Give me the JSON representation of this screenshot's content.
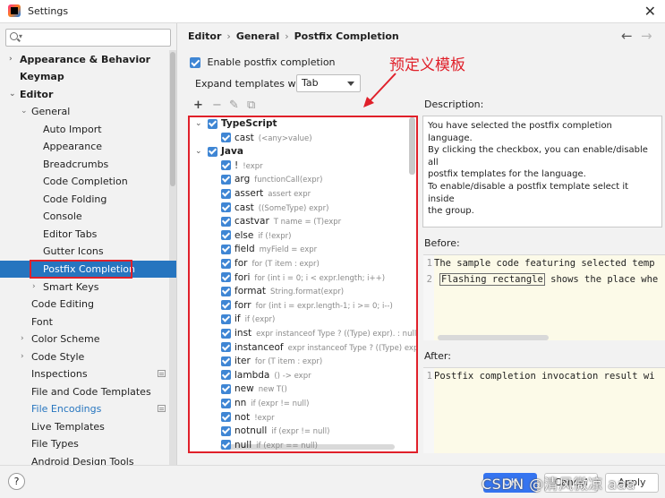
{
  "window": {
    "title": "Settings"
  },
  "sidebar": {
    "search_placeholder": "",
    "items": [
      {
        "label": "Appearance & Behavior",
        "arrow": "›"
      },
      {
        "label": "Keymap"
      },
      {
        "label": "Editor",
        "arrow": "⌄"
      },
      {
        "label": "General",
        "arrow": "⌄"
      },
      {
        "label": "Auto Import"
      },
      {
        "label": "Appearance"
      },
      {
        "label": "Breadcrumbs"
      },
      {
        "label": "Code Completion"
      },
      {
        "label": "Code Folding"
      },
      {
        "label": "Console"
      },
      {
        "label": "Editor Tabs"
      },
      {
        "label": "Gutter Icons"
      },
      {
        "label": "Postfix Completion"
      },
      {
        "label": "Smart Keys",
        "arrow": "›"
      },
      {
        "label": "Code Editing"
      },
      {
        "label": "Font"
      },
      {
        "label": "Color Scheme",
        "arrow": "›"
      },
      {
        "label": "Code Style",
        "arrow": "›"
      },
      {
        "label": "Inspections"
      },
      {
        "label": "File and Code Templates"
      },
      {
        "label": "File Encodings"
      },
      {
        "label": "Live Templates"
      },
      {
        "label": "File Types"
      },
      {
        "label": "Android Design Tools"
      }
    ]
  },
  "breadcrumb": {
    "parts": [
      "Editor",
      "General",
      "Postfix Completion"
    ],
    "sep": "›"
  },
  "nav": {
    "back": "←",
    "forward": "→"
  },
  "settings": {
    "enable_label": "Enable postfix completion",
    "expand_label": "Expand templates with",
    "expand_value": "Tab"
  },
  "annotation": {
    "text": "预定义模板"
  },
  "toolbar": {
    "add": "+",
    "remove": "−",
    "edit": "✎",
    "copy": "⧉"
  },
  "templates": {
    "groups": [
      {
        "name": "TypeScript",
        "items": [
          {
            "key": "cast",
            "example": "(<any>value)"
          }
        ]
      },
      {
        "name": "Java",
        "items": [
          {
            "key": "!",
            "example": "!expr"
          },
          {
            "key": "arg",
            "example": "functionCall(expr)"
          },
          {
            "key": "assert",
            "example": "assert expr"
          },
          {
            "key": "cast",
            "example": "((SomeType) expr)"
          },
          {
            "key": "castvar",
            "example": "T name = (T)expr"
          },
          {
            "key": "else",
            "example": "if (!expr)"
          },
          {
            "key": "field",
            "example": "myField = expr"
          },
          {
            "key": "for",
            "example": "for (T item : expr)"
          },
          {
            "key": "fori",
            "example": "for (int i = 0; i < expr.length; i++)"
          },
          {
            "key": "format",
            "example": "String.format(expr)"
          },
          {
            "key": "forr",
            "example": "for (int i = expr.length-1; i >= 0; i--)"
          },
          {
            "key": "if",
            "example": "if (expr)"
          },
          {
            "key": "inst",
            "example": "expr instanceof Type ? ((Type) expr). : null"
          },
          {
            "key": "instanceof",
            "example": "expr instanceof Type ? ((Type) expr). : null"
          },
          {
            "key": "iter",
            "example": "for (T item : expr)"
          },
          {
            "key": "lambda",
            "example": "() -> expr"
          },
          {
            "key": "new",
            "example": "new T()"
          },
          {
            "key": "nn",
            "example": "if (expr != null)"
          },
          {
            "key": "not",
            "example": "!expr"
          },
          {
            "key": "notnull",
            "example": "if (expr != null)"
          },
          {
            "key": "null",
            "example": "if (expr == null)"
          }
        ]
      }
    ]
  },
  "description": {
    "label": "Description:",
    "lines": [
      "You have selected the postfix completion language.",
      "By clicking the checkbox, you can enable/disable all",
      "postfix templates for the language.",
      "To enable/disable a postfix template select it inside",
      "the group."
    ]
  },
  "before": {
    "label": "Before:",
    "line1_num": "1",
    "line1": "The sample code featuring selected temp",
    "line2_num": "2",
    "line2_flash": "Flashing rectangle",
    "line2_rest": " shows the place whe"
  },
  "after": {
    "label": "After:",
    "line1_num": "1",
    "line1": "Postfix completion invocation result wi"
  },
  "buttons": {
    "help": "?",
    "ok": "OK",
    "cancel": "Cancel",
    "apply": "Apply"
  },
  "watermark": "CSDN @清风微凉 aaa",
  "colors": {
    "accent": "#2675bf",
    "annotation": "#e0202a",
    "checkbox": "#3f86d4",
    "code_bg": "#fcfae8"
  }
}
